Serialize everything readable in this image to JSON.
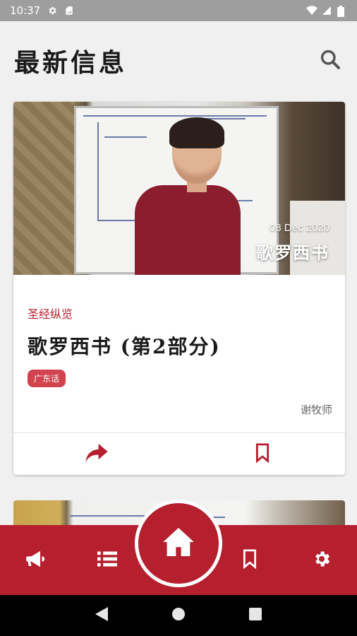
{
  "status_bar": {
    "time": "10:37",
    "icons": [
      "settings-gear-icon",
      "sim-card-icon",
      "wifi-icon",
      "signal-icon",
      "battery-icon"
    ]
  },
  "header": {
    "title": "最新信息",
    "search_icon": "search-icon"
  },
  "card": {
    "image_date": "08 Dec 2020",
    "image_caption": "歌罗西书",
    "category": "圣经纵览",
    "title": "歌罗西书 (第2部分)",
    "tag": "广东话",
    "author": "谢牧师",
    "actions": {
      "share_icon": "share-arrow-icon",
      "bookmark_icon": "bookmark-icon"
    }
  },
  "bottom_nav": {
    "items": [
      {
        "icon": "megaphone-icon"
      },
      {
        "icon": "list-icon"
      },
      {
        "icon": "home-icon"
      },
      {
        "icon": "bookmark-icon"
      },
      {
        "icon": "settings-gear-icon"
      }
    ]
  },
  "colors": {
    "accent": "#b51f2e",
    "tag": "#d0434f",
    "background": "#f0f0f0",
    "status_bar": "#9e9e9e"
  }
}
